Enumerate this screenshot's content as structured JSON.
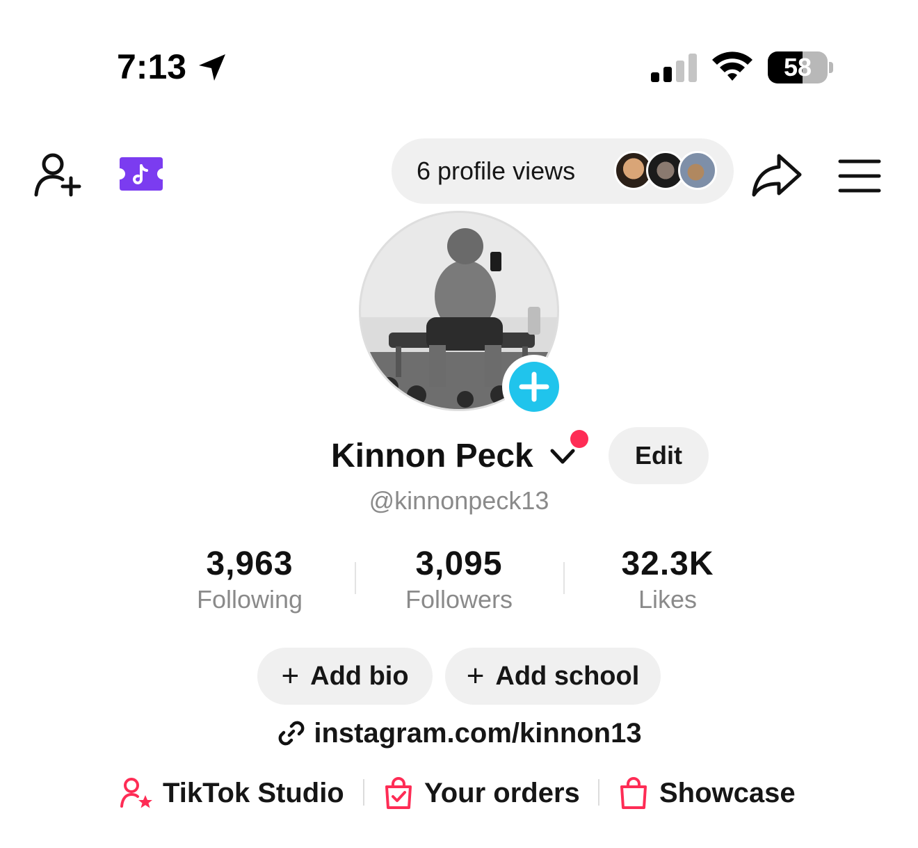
{
  "status_bar": {
    "time": "7:13",
    "battery_level": "58",
    "battery_fraction": 0.58
  },
  "top_bar": {
    "profile_views_label": "6 profile views"
  },
  "profile": {
    "display_name": "Kinnon Peck",
    "username": "@kinnonpeck13",
    "edit_label": "Edit"
  },
  "stats": [
    {
      "value": "3,963",
      "label": "Following"
    },
    {
      "value": "3,095",
      "label": "Followers"
    },
    {
      "value": "32.3K",
      "label": "Likes"
    }
  ],
  "actions": {
    "add_bio": "Add bio",
    "add_school": "Add school",
    "plus": "+"
  },
  "link": {
    "text": "instagram.com/kinnon13"
  },
  "shortcuts": [
    {
      "label": "TikTok Studio"
    },
    {
      "label": "Your orders"
    },
    {
      "label": "Showcase"
    }
  ],
  "colors": {
    "accent_red": "#fe2c55",
    "add_avatar_blue": "#20c4ec",
    "ticket_purple": "#7b3cf0",
    "pill_bg": "#f0f0f0",
    "muted_text": "#8a8a8a"
  },
  "icons": [
    "location-arrow-icon",
    "cellular-signal-icon",
    "wifi-icon",
    "battery-icon",
    "add-friend-icon",
    "tiktok-ticket-icon",
    "share-icon",
    "menu-icon",
    "plus-icon",
    "chevron-down-icon",
    "link-icon",
    "creator-star-icon",
    "order-bag-check-icon",
    "shopping-bag-icon"
  ]
}
